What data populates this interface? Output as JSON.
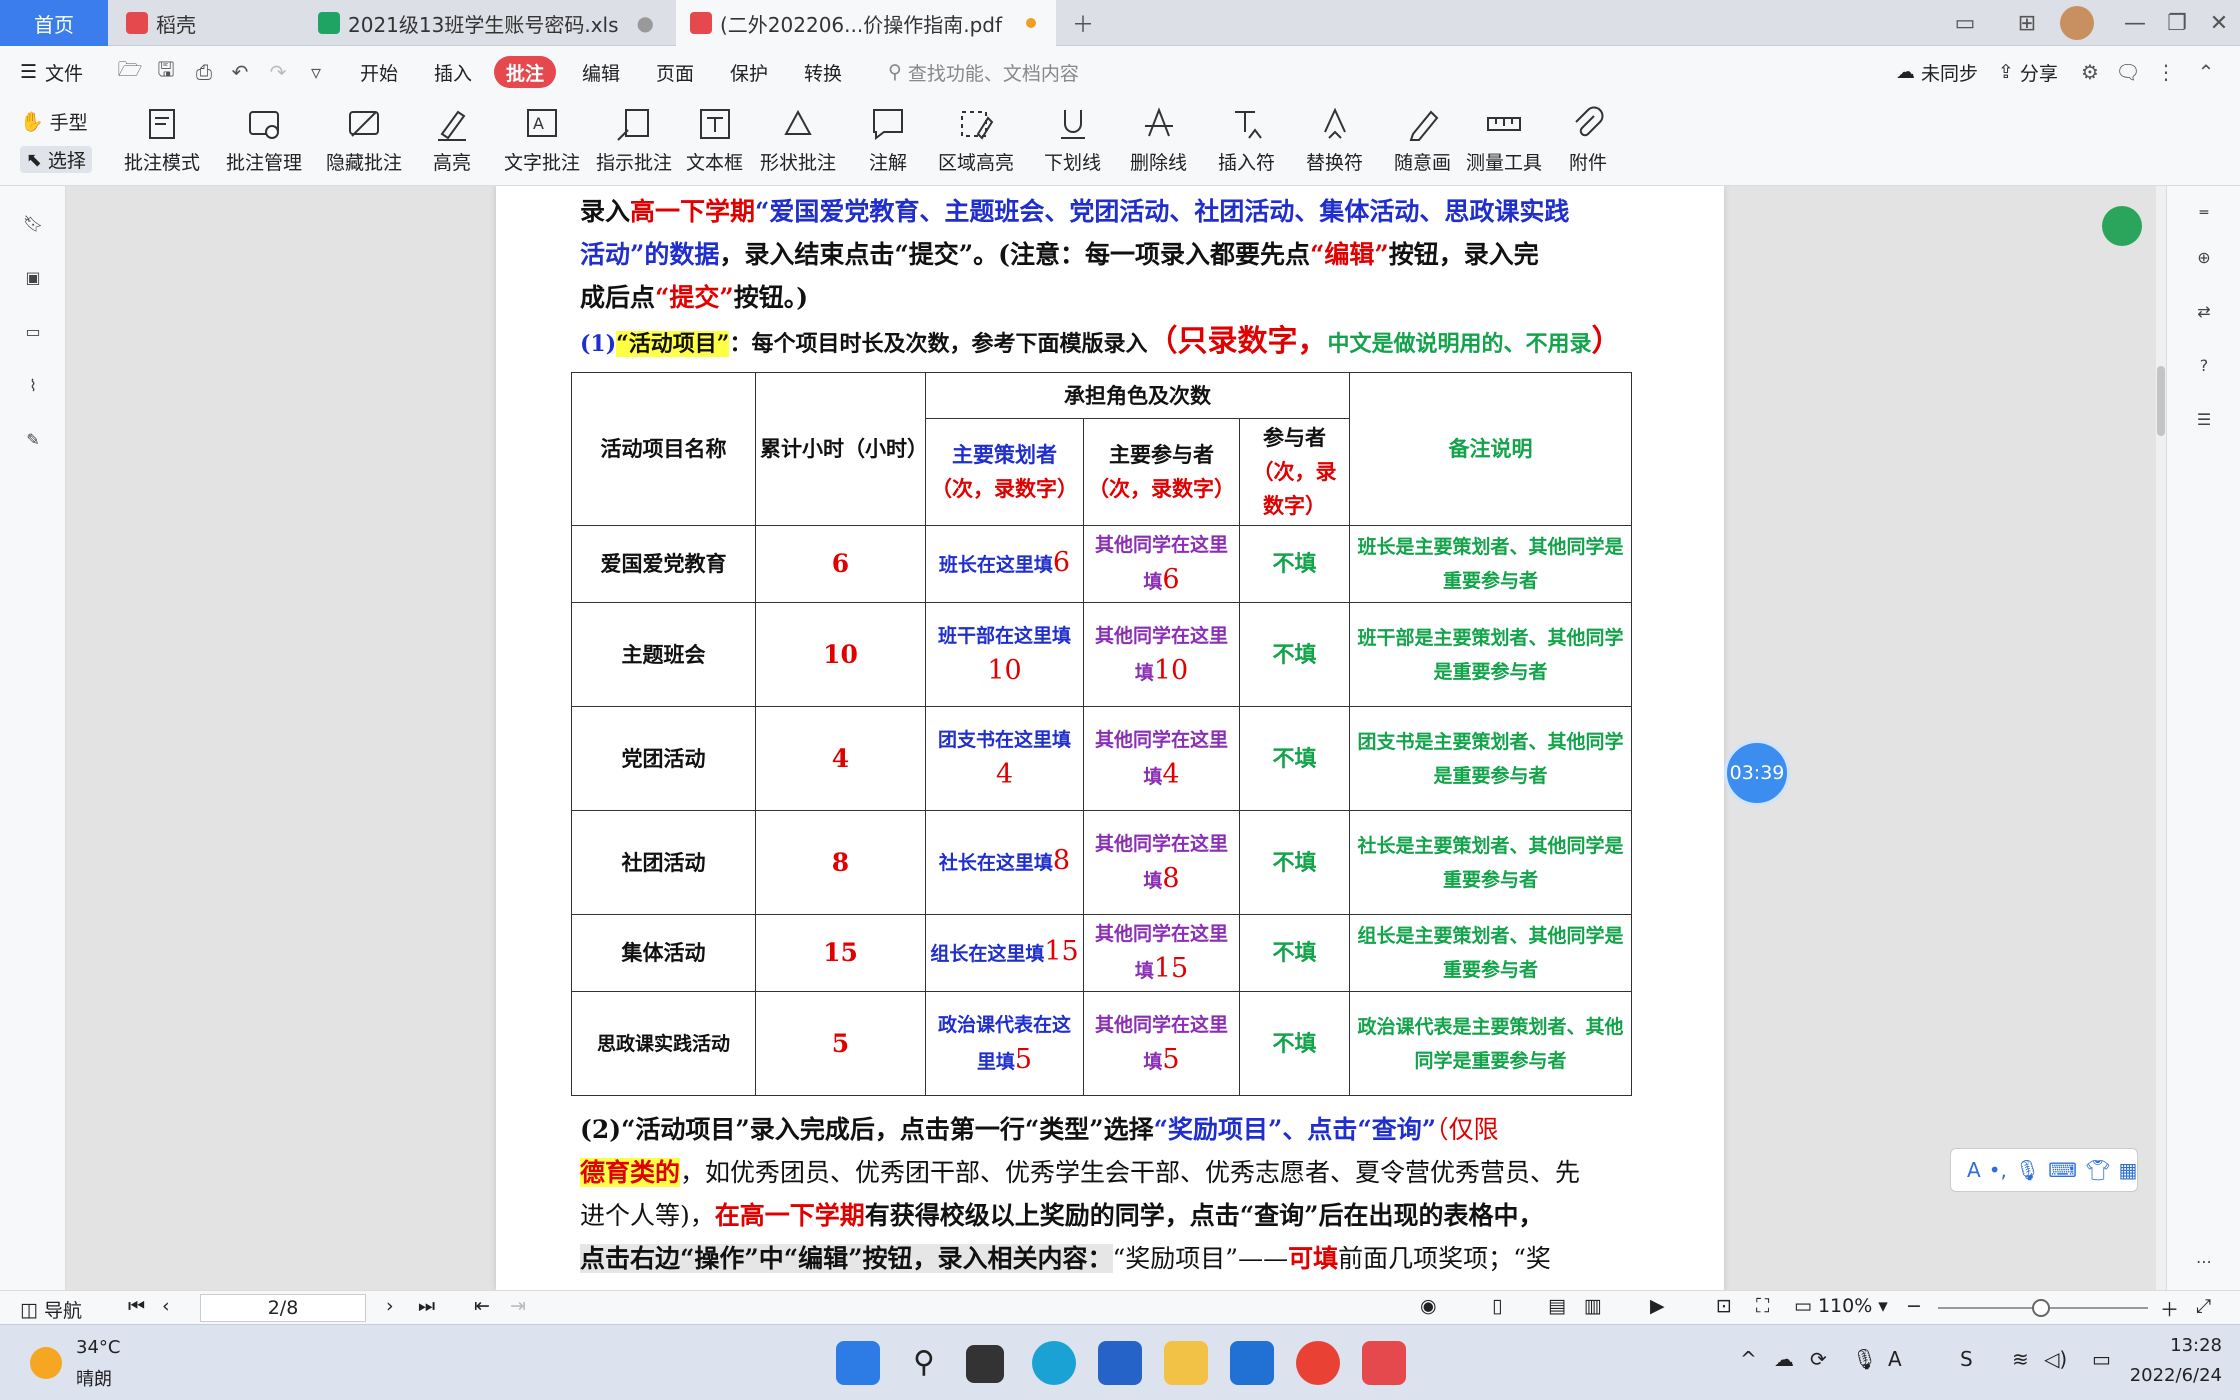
{
  "tabs": [
    {
      "label": "首页"
    },
    {
      "label": "稻壳"
    },
    {
      "label": "2021级13班学生账号密码.xls"
    },
    {
      "label": "(二外202206...价操作指南.pdf"
    }
  ],
  "menu": {
    "file": "文件",
    "items": [
      "开始",
      "插入",
      "批注",
      "编辑",
      "页面",
      "保护",
      "转换"
    ],
    "search_placeholder": "查找功能、文档内容",
    "sync": "未同步",
    "share": "分享"
  },
  "toolbar": {
    "hand": "手型",
    "select": "选择",
    "tools": [
      "批注模式",
      "批注管理",
      "隐藏批注",
      "高亮",
      "文字批注",
      "指示批注",
      "文本框",
      "形状批注",
      "注解",
      "区域高亮",
      "下划线",
      "删除线",
      "插入符",
      "替换符",
      "随意画",
      "测量工具",
      "附件"
    ]
  },
  "doc": {
    "p1a": "录入",
    "p1b": "高一下学期",
    "p1c": "“爱国爱党教育、主题班会、党团活动、社团活动、集体活动、思政课实践",
    "p2a": "活动”的数据",
    "p2b": "，录入结束点击“提交”。(注意：每一项录入都要先点",
    "p2c": "“编辑”",
    "p2d": "按钮，录入完",
    "p3a": "成后点",
    "p3b": "“提交”",
    "p3c": "按钮。)",
    "p4a": "(1)",
    "p4b": "“活动项目”",
    "p4c": "：每个项目时长及次数，参考下面模版录入",
    "p4d": "（只录数字，",
    "p4e": "中文是做说明用的、不用录",
    "p4f": "）",
    "table": {
      "h_name": "活动项目名称",
      "h_hours": "累计小时（小时）",
      "h_roles": "承担角色及次数",
      "h_planner": "主要策划者",
      "h_planner_sub": "（次，录数字）",
      "h_part": "主要参与者",
      "h_part_sub": "（次，录数字）",
      "h_other": "参与者",
      "h_other_sub": "（次，录数字）",
      "h_note": "备注说明",
      "rows": [
        {
          "name": "爱国爱党教育",
          "hours": "6",
          "planner": "班长在这里填",
          "planner_n": "6",
          "part": "其他同学在这里填",
          "part_n": "6",
          "other": "不填",
          "note": "班长是主要策划者、其他同学是重要参与者"
        },
        {
          "name": "主题班会",
          "hours": "10",
          "planner": "班干部在这里填",
          "planner_n": "10",
          "part": "其他同学在这里填",
          "part_n": "10",
          "other": "不填",
          "note": "班干部是主要策划者、其他同学是重要参与者"
        },
        {
          "name": "党团活动",
          "hours": "4",
          "planner": "团支书在这里填",
          "planner_n": "4",
          "part": "其他同学在这里填",
          "part_n": "4",
          "other": "不填",
          "note": "团支书是主要策划者、其他同学是重要参与者"
        },
        {
          "name": "社团活动",
          "hours": "8",
          "planner": "社长在这里填",
          "planner_n": "8",
          "part": "其他同学在这里填",
          "part_n": "8",
          "other": "不填",
          "note": "社长是主要策划者、其他同学是重要参与者"
        },
        {
          "name": "集体活动",
          "hours": "15",
          "planner": "组长在这里填",
          "planner_n": "15",
          "part": "其他同学在这里填",
          "part_n": "15",
          "other": "不填",
          "note": "组长是主要策划者、其他同学是重要参与者"
        },
        {
          "name": "思政课实践活动",
          "hours": "5",
          "planner": "政治课代表在这里填",
          "planner_n": "5",
          "part": "其他同学在这里填",
          "part_n": "5",
          "other": "不填",
          "note": "政治课代表是主要策划者、其他同学是重要参与者"
        }
      ]
    },
    "q1a": "(2)“活动项目”录入完成后，点击第一行“类型”选择",
    "q1b": "“奖励项目”、点击“查询”",
    "q1c": "（仅限",
    "q2a": "德育类的",
    "q2b": "，如优秀团员、优秀团干部、优秀学生会干部、优秀志愿者、夏令营优秀营员、先",
    "q3a": "进个人等)，",
    "q3b": "在高一下学期",
    "q3c": "有获得校级以上奖励的同学，点击“查询”后在出现的表格中，",
    "q4a": "点击右边“操作”中“编辑”按钮，录入相关内容：",
    "q4b": "“奖励项目”——",
    "q4c": "可填",
    "q4d": "前面几项奖项；“奖"
  },
  "timer": "03:39",
  "status": {
    "nav": "导航",
    "page": "2/8",
    "zoom": "110%"
  },
  "taskbar": {
    "temp": "34°C",
    "weather": "晴朗",
    "time": "13:28",
    "date": "2022/6/24"
  }
}
